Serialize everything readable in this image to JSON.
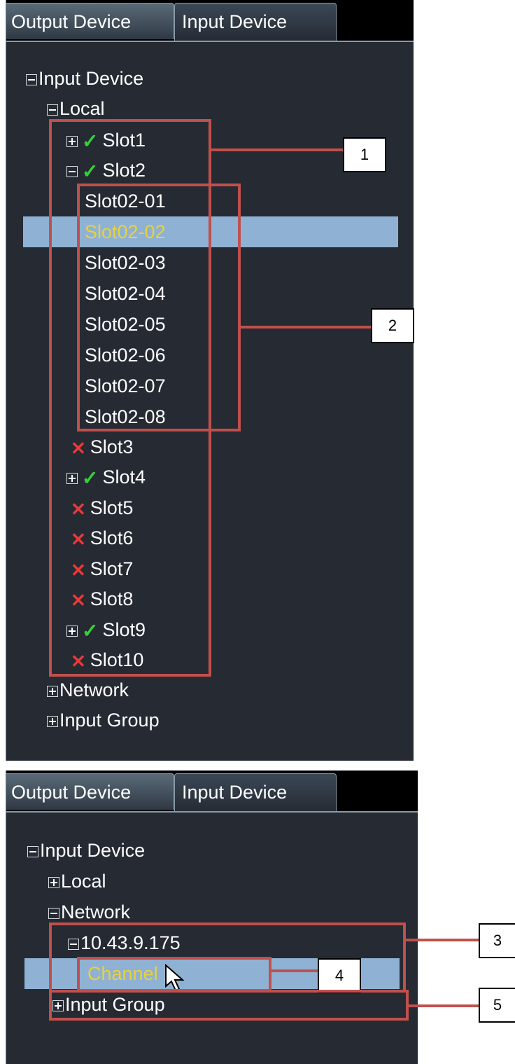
{
  "panel_a": {
    "tabs": [
      "Output Device",
      "Input Device"
    ],
    "tree": {
      "root": "Input Device",
      "local": "Local",
      "slots": [
        {
          "label": "Slot1",
          "status": "ok",
          "expander": "plus"
        },
        {
          "label": "Slot2",
          "status": "ok",
          "expander": "minus"
        }
      ],
      "slot2_children": [
        "Slot02-01",
        "Slot02-02",
        "Slot02-03",
        "Slot02-04",
        "Slot02-05",
        "Slot02-06",
        "Slot02-07",
        "Slot02-08"
      ],
      "selected_child": "Slot02-02",
      "more_slots": [
        {
          "label": "Slot3",
          "status": "error"
        },
        {
          "label": "Slot4",
          "status": "ok",
          "expander": "plus"
        },
        {
          "label": "Slot5",
          "status": "error"
        },
        {
          "label": "Slot6",
          "status": "error"
        },
        {
          "label": "Slot7",
          "status": "error"
        },
        {
          "label": "Slot8",
          "status": "error"
        },
        {
          "label": "Slot9",
          "status": "ok",
          "expander": "plus"
        },
        {
          "label": "Slot10",
          "status": "error"
        }
      ],
      "network": "Network",
      "input_group": "Input Group"
    }
  },
  "panel_b": {
    "tabs": [
      "Output Device",
      "Input Device"
    ],
    "tree": {
      "root": "Input Device",
      "local": "Local",
      "network": "Network",
      "ip": "10.43.9.175",
      "channel": "Channel 1",
      "input_group": "Input Group"
    }
  },
  "annotations": [
    "1",
    "2",
    "3",
    "4",
    "5"
  ],
  "colors": {
    "annotation": "#c0504d",
    "selection": "#8fb2d4",
    "selected_text": "#e8d23a",
    "ok": "#34d13a",
    "error": "#e83a3a",
    "panel": "#252a33"
  }
}
